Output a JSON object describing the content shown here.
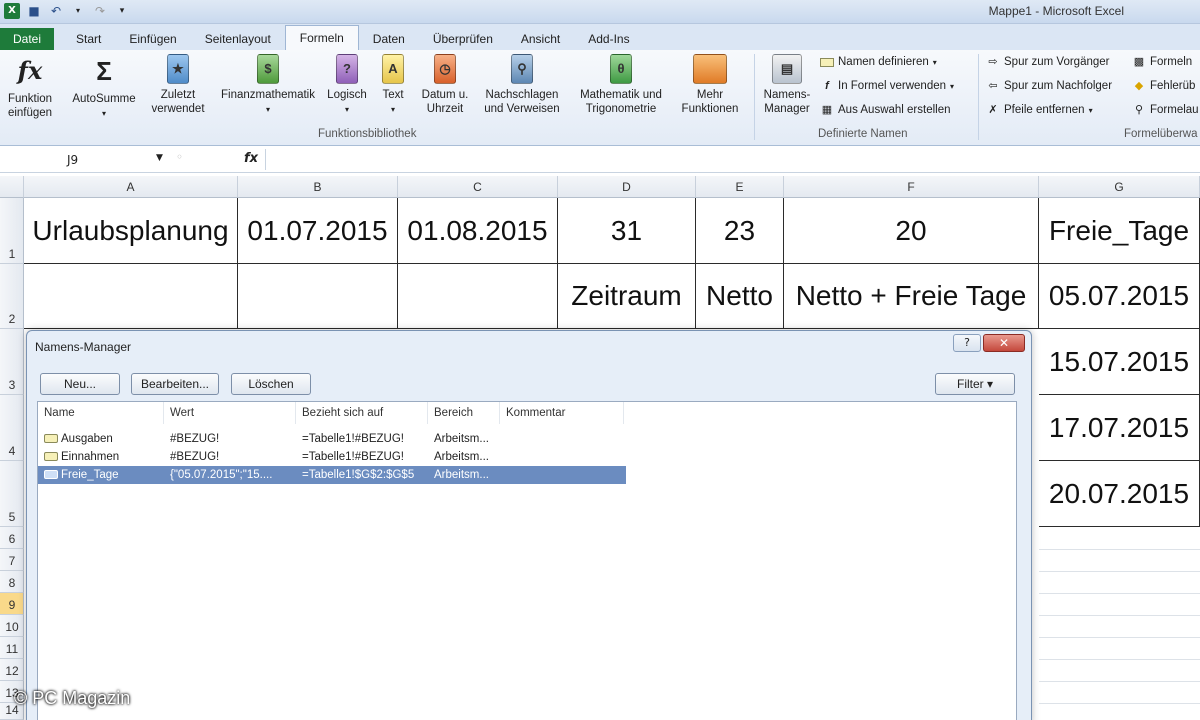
{
  "window": {
    "title": "Mappe1 - Microsoft Excel"
  },
  "tabs": [
    "Datei",
    "Start",
    "Einfügen",
    "Seitenlayout",
    "Formeln",
    "Daten",
    "Überprüfen",
    "Ansicht",
    "Add-Ins"
  ],
  "ribbon": {
    "funktion_einfuegen": "Funktion\neinfügen",
    "autosumme": "AutoSumme",
    "zuletzt": "Zuletzt\nverwendet",
    "finanz": "Finanzmathematik",
    "logisch": "Logisch",
    "text": "Text",
    "datum": "Datum u.\nUhrzeit",
    "nachschlagen": "Nachschlagen\nund Verweisen",
    "mathe": "Mathematik und\nTrigonometrie",
    "mehr": "Mehr\nFunktionen",
    "funktionsbibliothek": "Funktionsbibliothek",
    "namens_manager": "Namens-\nManager",
    "namen_definieren": "Namen definieren",
    "in_formel": "In Formel verwenden",
    "aus_auswahl": "Aus Auswahl erstellen",
    "definierte_namen": "Definierte Namen",
    "spur_vorgaenger": "Spur zum Vorgänger",
    "spur_nachfolger": "Spur zum Nachfolger",
    "pfeile_entfernen": "Pfeile entfernen",
    "formeln_anz": "Formeln",
    "fehleruebe": "Fehlerüb",
    "formelausw": "Formelau",
    "formelueberwachung": "Formelüberwa"
  },
  "formula_bar": {
    "name_box": "J9",
    "fx": "fx",
    "value": ""
  },
  "columns": [
    "A",
    "B",
    "C",
    "D",
    "E",
    "F",
    "G"
  ],
  "rows": [
    "1",
    "2",
    "3",
    "4",
    "5",
    "6",
    "7",
    "8",
    "9",
    "10",
    "11",
    "12",
    "13",
    "14"
  ],
  "selected_row": "9",
  "cells": {
    "A1": "Urlaubsplanung",
    "B1": "01.07.2015",
    "C1": "01.08.2015",
    "D1": "31",
    "E1": "23",
    "F1": "20",
    "G1": "Freie_Tage",
    "D2": "Zeitraum",
    "E2": "Netto",
    "F2": "Netto + Freie Tage",
    "G2": "05.07.2015",
    "G3": "15.07.2015",
    "G4": "17.07.2015",
    "G5": "20.07.2015"
  },
  "dialog": {
    "title": "Namens-Manager",
    "help": "?",
    "close": "✕",
    "buttons": {
      "neu": "Neu...",
      "bearbeiten": "Bearbeiten...",
      "loeschen": "Löschen",
      "filter": "Filter ▾"
    },
    "columns": [
      "Name",
      "Wert",
      "Bezieht sich auf",
      "Bereich",
      "Kommentar"
    ],
    "entries": [
      {
        "name": "Ausgaben",
        "wert": "#BEZUG!",
        "bezug": "=Tabelle1!#BEZUG!",
        "bereich": "Arbeitsm...",
        "kommentar": ""
      },
      {
        "name": "Einnahmen",
        "wert": "#BEZUG!",
        "bezug": "=Tabelle1!#BEZUG!",
        "bereich": "Arbeitsm...",
        "kommentar": ""
      },
      {
        "name": "Freie_Tage",
        "wert": "{\"05.07.2015\";\"15....",
        "bezug": "=Tabelle1!$G$2:$G$5",
        "bereich": "Arbeitsm...",
        "kommentar": ""
      }
    ],
    "selected_entry": 2
  },
  "watermark": "© PC Magazin",
  "colors": {
    "file_tab": "#1e7b3a",
    "selection": "#6b8cc0",
    "row_highlight": "#f9d98a"
  }
}
